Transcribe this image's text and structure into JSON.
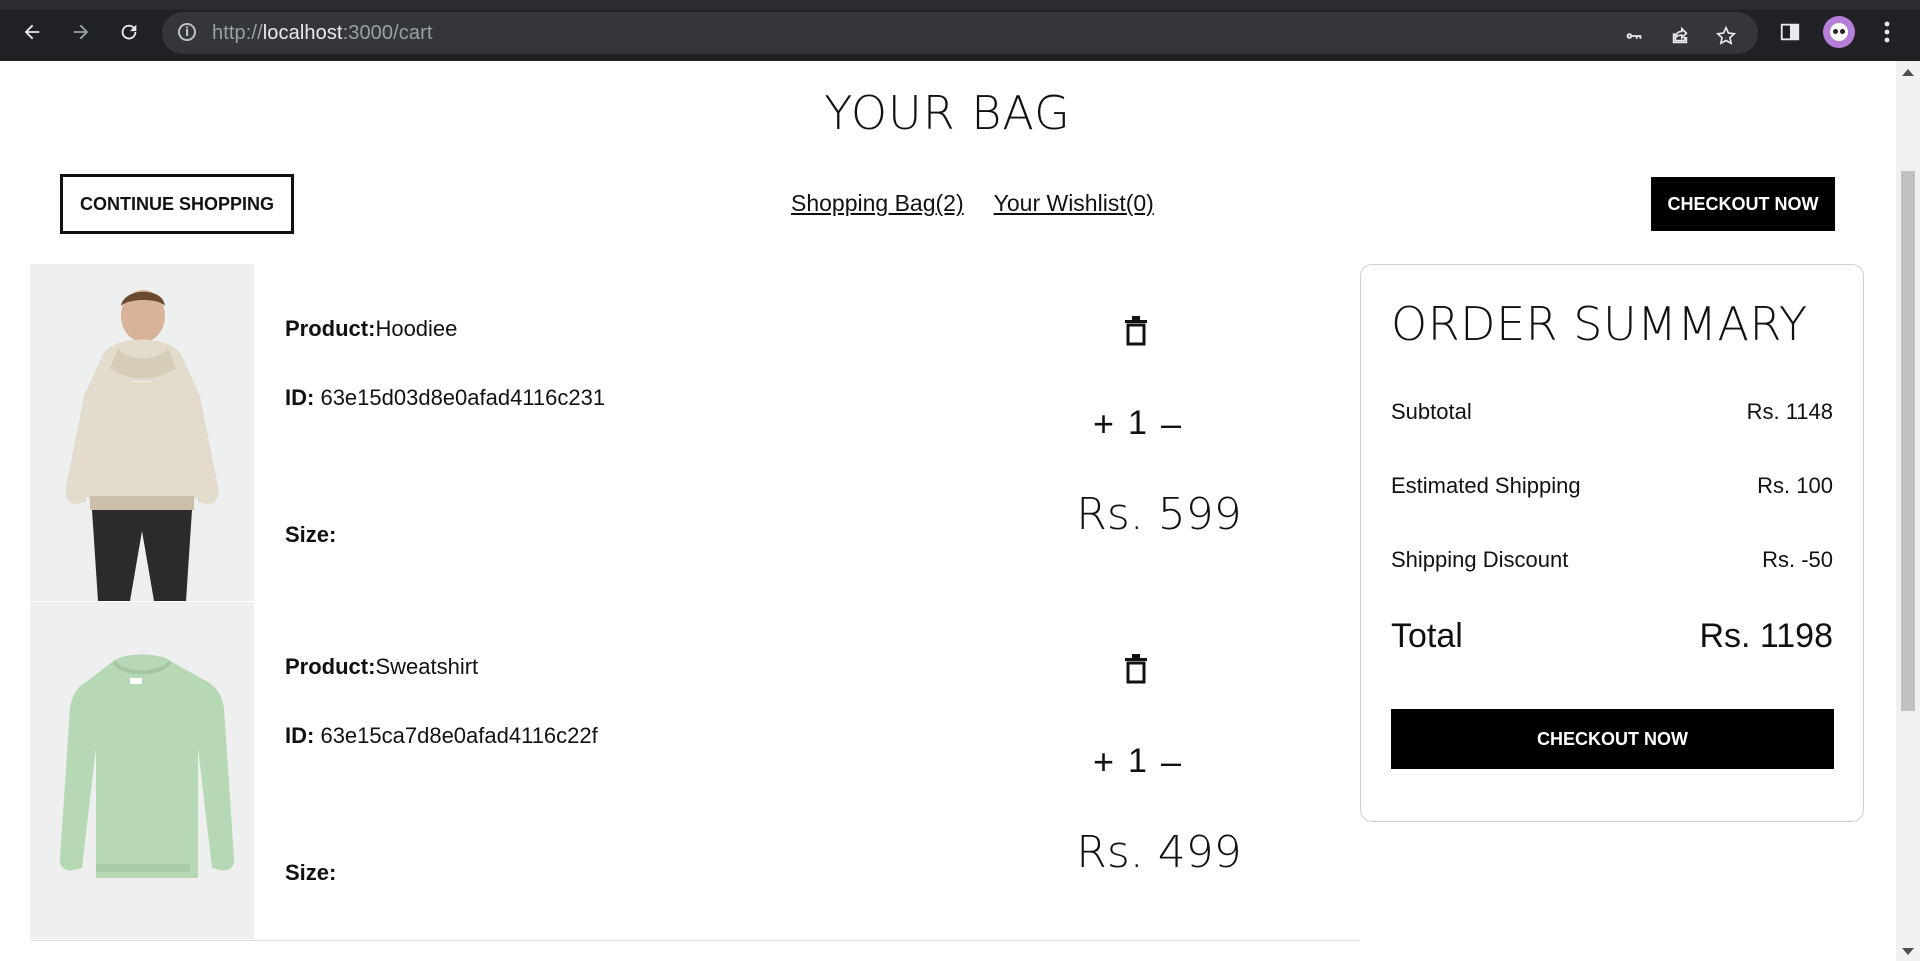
{
  "browser": {
    "url_prefix": "http://",
    "url_host": "localhost",
    "url_rest": ":3000/cart"
  },
  "page": {
    "title": "YOUR BAG",
    "continue_label": "CONTINUE SHOPPING",
    "bag_link": "Shopping Bag(2)",
    "wishlist_link": "Your Wishlist(0)",
    "checkout_top_label": "CHECKOUT NOW"
  },
  "products": [
    {
      "product_label": "Product:",
      "product_name": "Hoodiee",
      "id_label": "ID:",
      "id_value": "63e15d03d8e0afad4116c231",
      "size_label": "Size:",
      "qty_plus": "+",
      "quantity": "1",
      "qty_minus": "–",
      "price": "Rs. 599",
      "image_color": "#e3dccd"
    },
    {
      "product_label": "Product:",
      "product_name": "Sweatshirt",
      "id_label": "ID:",
      "id_value": "63e15ca7d8e0afad4116c22f",
      "size_label": "Size:",
      "qty_plus": "+",
      "quantity": "1",
      "qty_minus": "–",
      "price": "Rs. 499",
      "image_color": "#b7d8b4"
    }
  ],
  "summary": {
    "title": "ORDER SUMMARY",
    "subtotal_label": "Subtotal",
    "subtotal_value": "Rs. 1148",
    "shipping_label": "Estimated Shipping",
    "shipping_value": "Rs. 100",
    "discount_label": "Shipping Discount",
    "discount_value": "Rs. -50",
    "total_label": "Total",
    "total_value": "Rs. 1198",
    "checkout_label": "CHECKOUT NOW"
  },
  "icons": {
    "back": "arrow-left",
    "forward": "arrow-right",
    "reload": "reload",
    "site_info": "info",
    "password": "key",
    "share": "share",
    "bookmark": "star",
    "side_panel": "side-panel",
    "profile": "avatar",
    "menu": "more-vertical",
    "delete": "trash"
  }
}
